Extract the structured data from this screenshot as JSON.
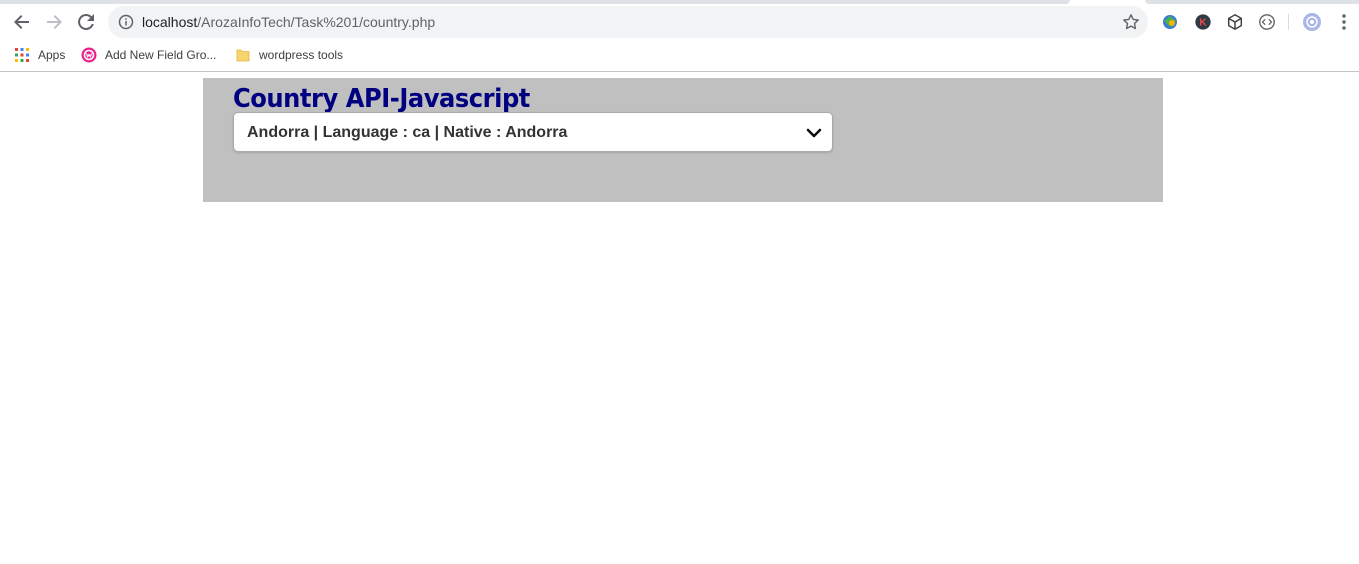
{
  "browser": {
    "url_host": "localhost",
    "url_path": "/ArozaInfoTech/Task%201/country.php"
  },
  "bookmarks": [
    {
      "label": "Apps",
      "icon": "apps-grid-icon"
    },
    {
      "label": "Add New Field Gro...",
      "icon": "wp-plugin-icon"
    },
    {
      "label": "wordpress tools",
      "icon": "folder-icon"
    }
  ],
  "page": {
    "title": "Country API-Javascript",
    "country_select": {
      "selected": "Andorra | Language : ca | Native : Andorra"
    }
  },
  "colors": {
    "title": "#000080",
    "panel_bg": "#c0c0c0"
  }
}
